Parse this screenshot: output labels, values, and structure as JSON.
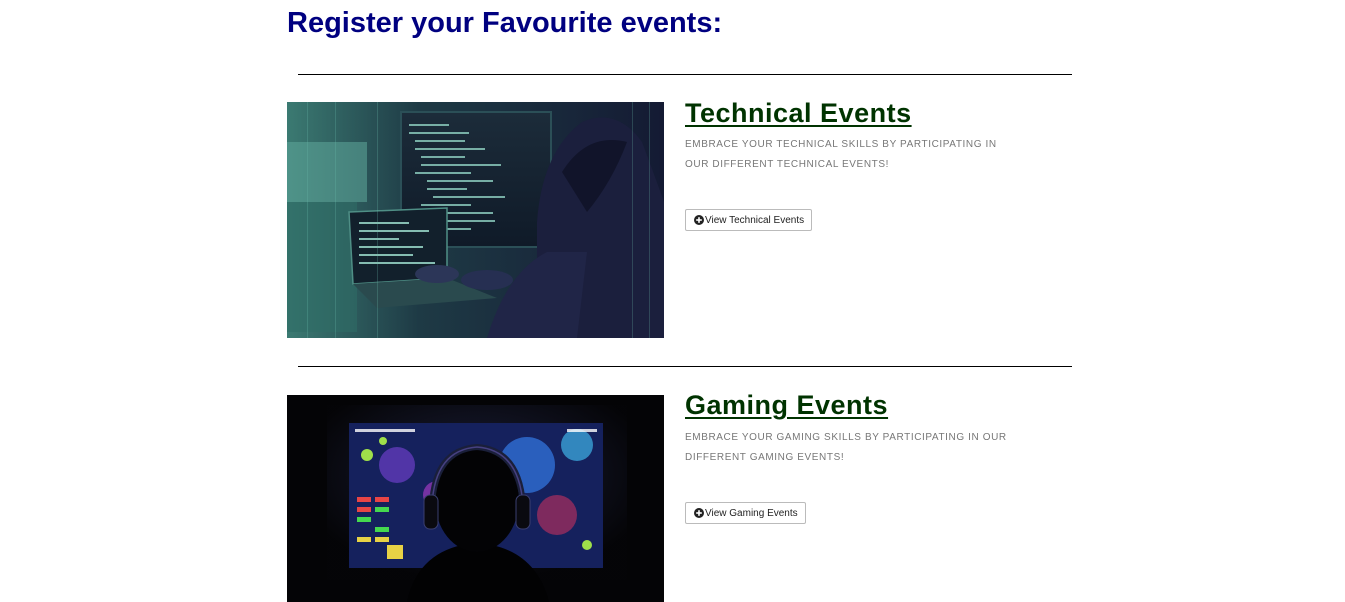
{
  "page": {
    "title": "Register your Favourite events:"
  },
  "events": [
    {
      "heading": "Technical Events",
      "description": "Embrace your technical skills by participating in our different technical events!",
      "button_label": "View Technical Events",
      "button_icon": "plus-circle-icon",
      "image_subject": "hacker-at-laptop-image"
    },
    {
      "heading": "Gaming Events",
      "description": "Embrace your gaming skills by participating in our different gaming events!",
      "button_label": "View Gaming Events",
      "button_icon": "plus-circle-icon",
      "image_subject": "gamer-with-headset-image"
    }
  ],
  "colors": {
    "title": "#000080",
    "heading": "#003300",
    "description": "#777777",
    "divider": "#000000"
  }
}
